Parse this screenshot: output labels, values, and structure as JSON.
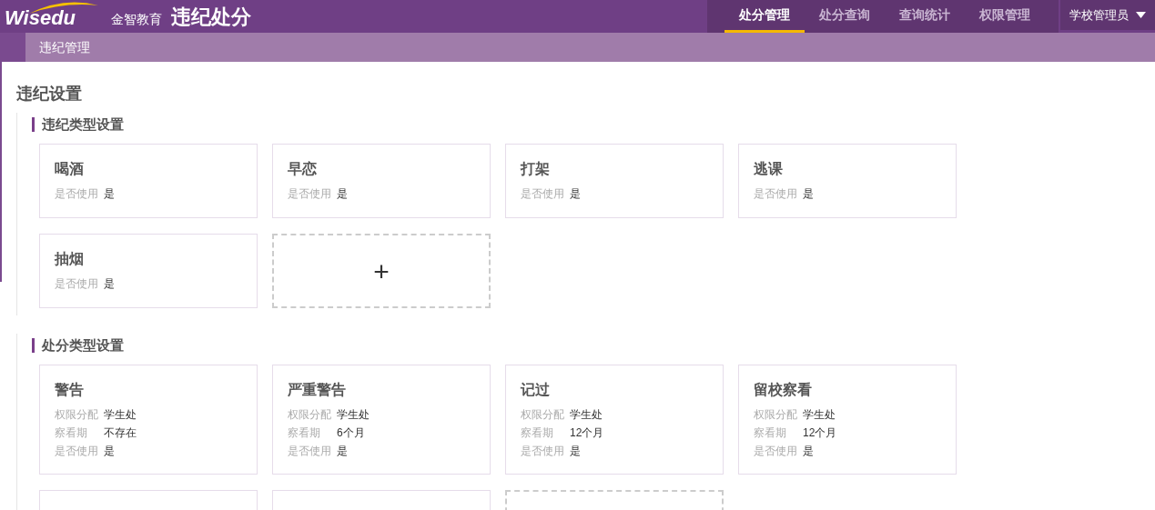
{
  "header": {
    "logo": "Wisedu",
    "logo_subtitle": "金智教育",
    "app_title": "违纪处分",
    "nav": [
      {
        "label": "处分管理",
        "selected": true
      },
      {
        "label": "处分查询",
        "selected": false
      },
      {
        "label": "查询统计",
        "selected": false
      },
      {
        "label": "权限管理",
        "selected": false
      }
    ],
    "user_menu": "学校管理员"
  },
  "breadcrumb": "违纪管理",
  "page_title": "违纪设置",
  "sections": [
    {
      "title": "违纪类型设置",
      "cards": [
        {
          "kind": "card",
          "title": "喝酒",
          "fields": [
            {
              "label": "是否使用",
              "value": "是"
            }
          ]
        },
        {
          "kind": "card",
          "title": "早恋",
          "fields": [
            {
              "label": "是否使用",
              "value": "是"
            }
          ]
        },
        {
          "kind": "card",
          "title": "打架",
          "fields": [
            {
              "label": "是否使用",
              "value": "是"
            }
          ]
        },
        {
          "kind": "card",
          "title": "逃课",
          "fields": [
            {
              "label": "是否使用",
              "value": "是"
            }
          ]
        },
        {
          "kind": "card",
          "title": "抽烟",
          "fields": [
            {
              "label": "是否使用",
              "value": "是"
            }
          ]
        },
        {
          "kind": "add",
          "symbol": "+"
        }
      ]
    },
    {
      "title": "处分类型设置",
      "cards": [
        {
          "kind": "card",
          "title": "警告",
          "fields": [
            {
              "label": "权限分配",
              "value": "学生处"
            },
            {
              "label": "察看期",
              "value": "不存在"
            },
            {
              "label": "是否使用",
              "value": "是"
            }
          ]
        },
        {
          "kind": "card",
          "title": "严重警告",
          "fields": [
            {
              "label": "权限分配",
              "value": "学生处"
            },
            {
              "label": "察看期",
              "value": "6个月"
            },
            {
              "label": "是否使用",
              "value": "是"
            }
          ]
        },
        {
          "kind": "card",
          "title": "记过",
          "fields": [
            {
              "label": "权限分配",
              "value": "学生处"
            },
            {
              "label": "察看期",
              "value": "12个月"
            },
            {
              "label": "是否使用",
              "value": "是"
            }
          ]
        },
        {
          "kind": "card",
          "title": "留校察看",
          "fields": [
            {
              "label": "权限分配",
              "value": "学生处"
            },
            {
              "label": "察看期",
              "value": "12个月"
            },
            {
              "label": "是否使用",
              "value": "是"
            }
          ]
        },
        {
          "kind": "card"
        },
        {
          "kind": "card"
        },
        {
          "kind": "add"
        }
      ]
    }
  ]
}
